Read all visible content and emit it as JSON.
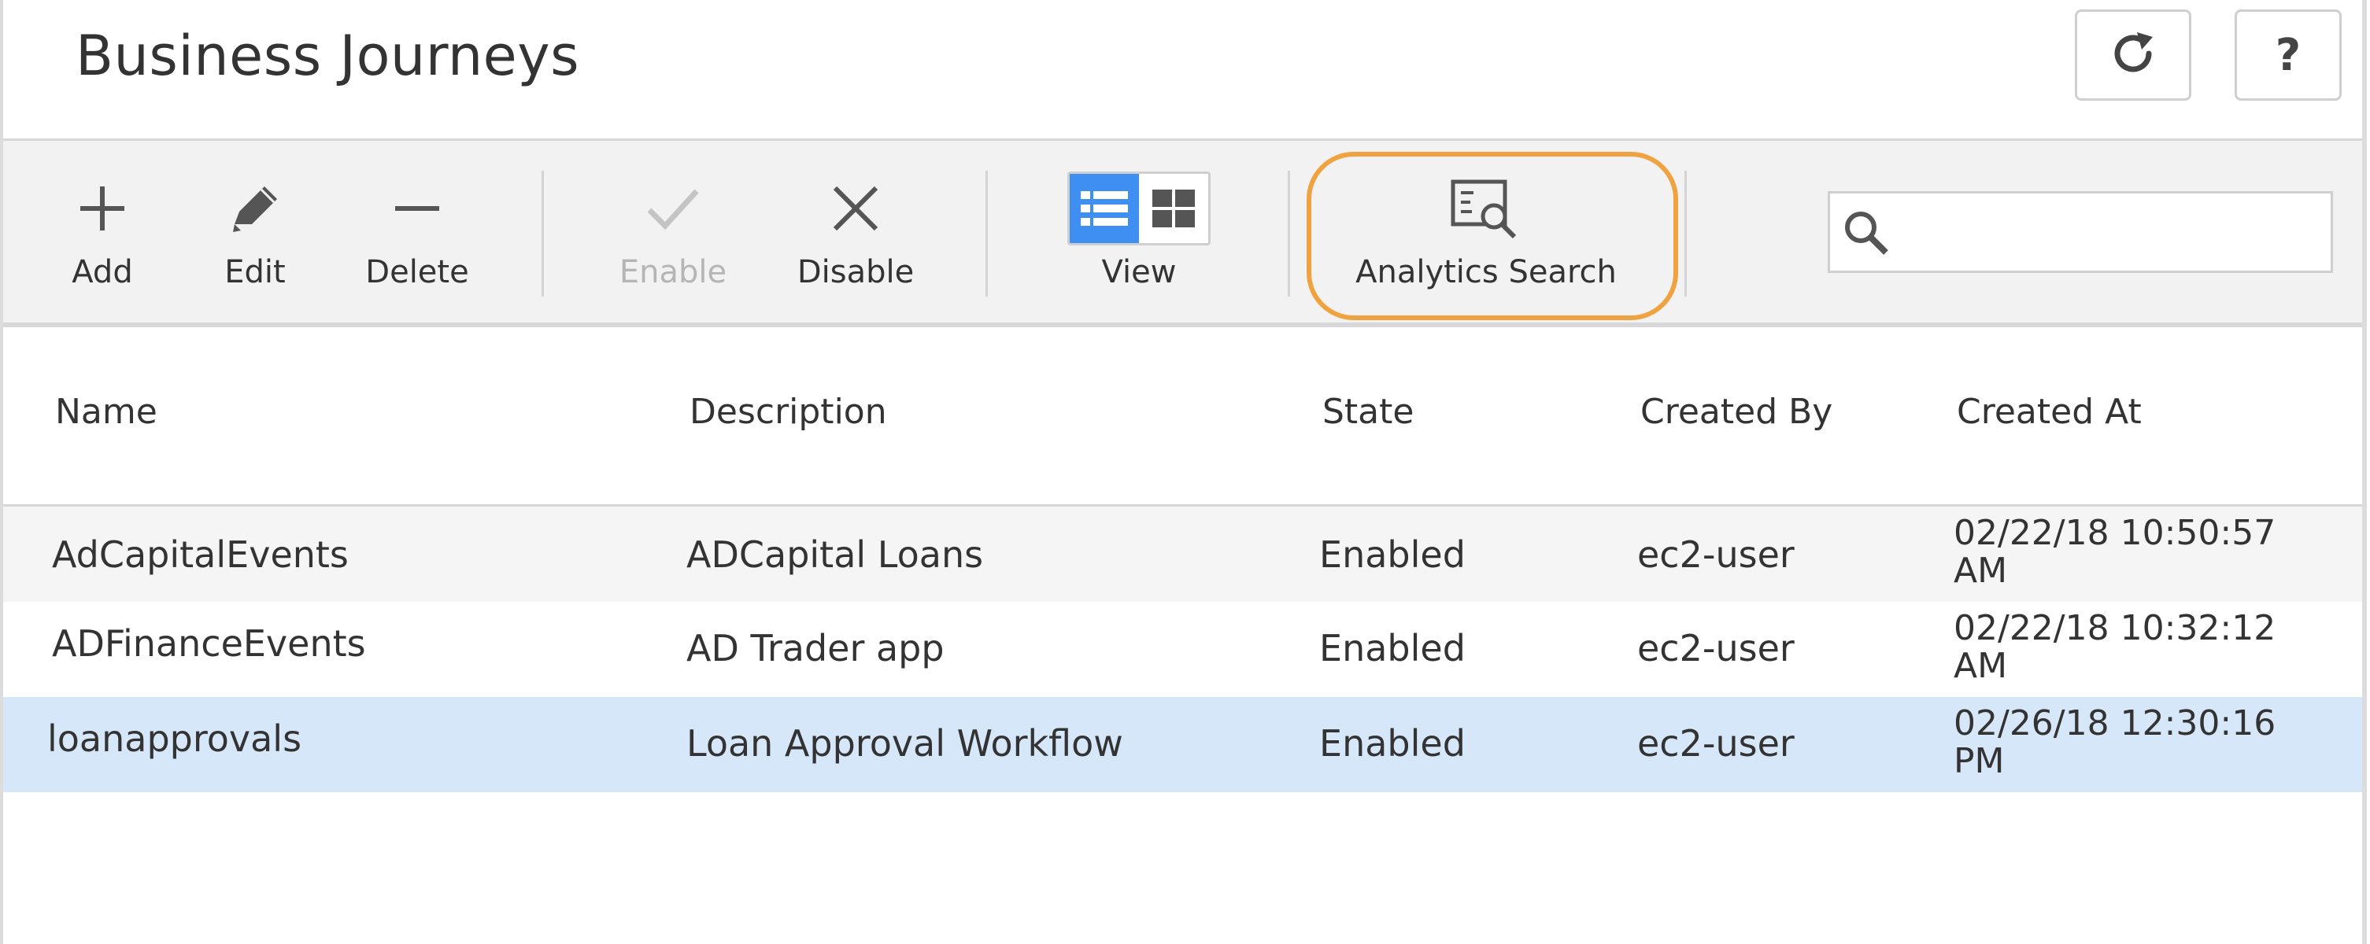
{
  "header": {
    "title": "Business Journeys",
    "refresh_icon": "refresh-icon",
    "help_label": "?"
  },
  "toolbar": {
    "add_label": "Add",
    "edit_label": "Edit",
    "delete_label": "Delete",
    "enable_label": "Enable",
    "disable_label": "Disable",
    "view_label": "View",
    "analytics_search_label": "Analytics Search",
    "enable_disabled": true,
    "view_mode": "list",
    "highlight_color": "#f0a240",
    "active_view_color": "#3f8ef2"
  },
  "search": {
    "value": "",
    "placeholder": ""
  },
  "table": {
    "columns": [
      "Name",
      "Description",
      "State",
      "Created By",
      "Created At"
    ],
    "rows": [
      {
        "name": "AdCapitalEvents",
        "description": "ADCapital Loans",
        "state": "Enabled",
        "created_by": "ec2-user",
        "created_at": "02/22/18 10:50:57 AM"
      },
      {
        "name": "ADFinanceEvents",
        "description": "AD Trader app",
        "state": "Enabled",
        "created_by": "ec2-user",
        "created_at": "02/22/18 10:32:12 AM"
      },
      {
        "name": "loanapprovals",
        "description": "Loan Approval Workflow",
        "state": "Enabled",
        "created_by": "ec2-user",
        "created_at": "02/26/18 12:30:16 PM"
      }
    ],
    "selected_row": 2,
    "selected_color": "#d7e7fa"
  }
}
